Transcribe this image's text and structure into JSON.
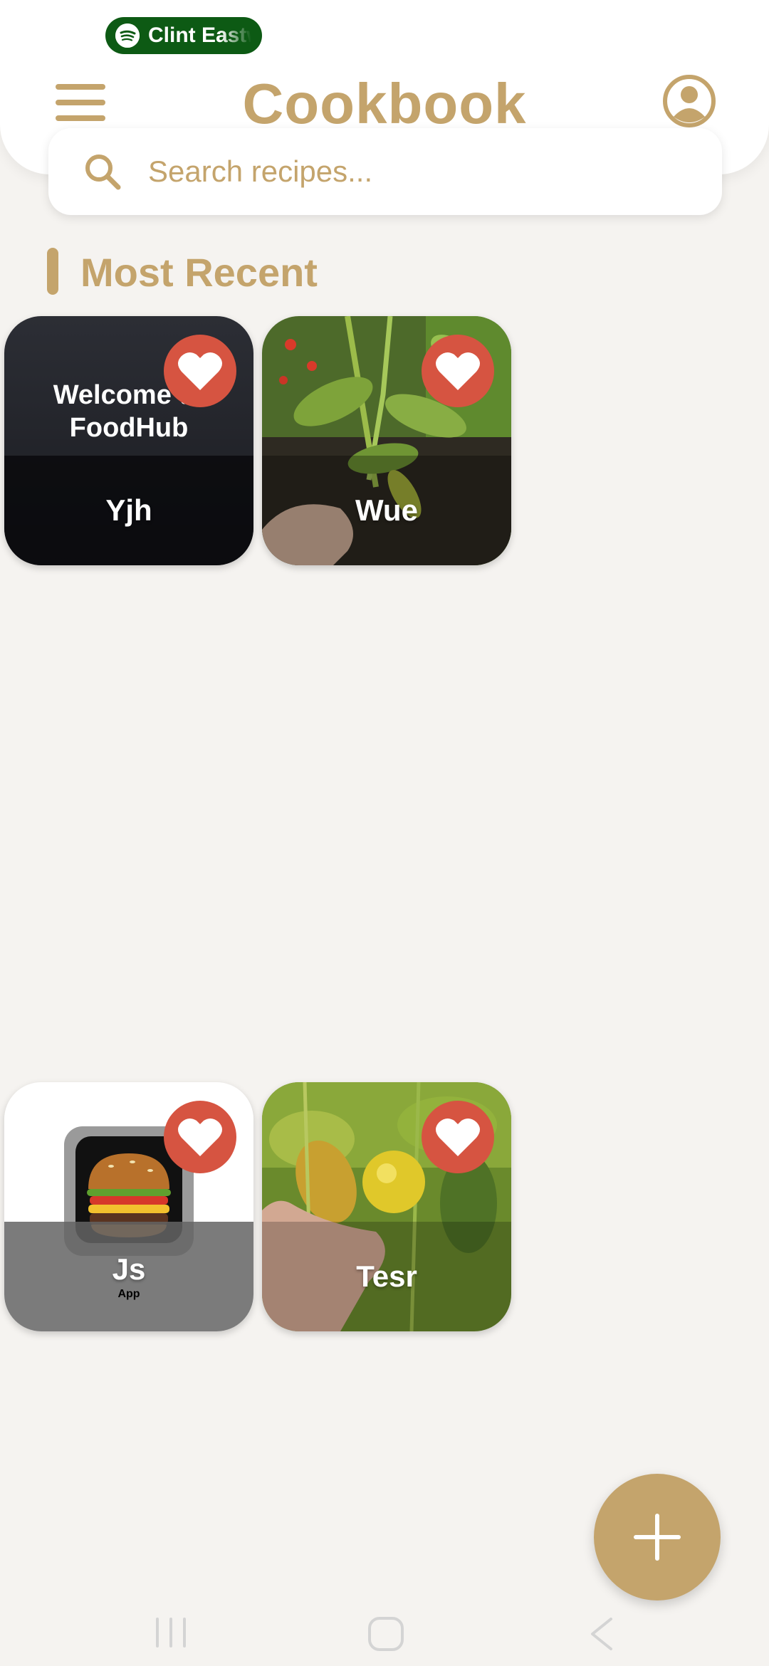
{
  "status": {
    "now_playing": "Clint Eastwood"
  },
  "header": {
    "title": "Cookbook",
    "menu_icon": "hamburger-menu-icon",
    "profile_icon": "account-circle-icon"
  },
  "search": {
    "placeholder": "Search recipes...",
    "value": ""
  },
  "section": {
    "title": "Most Recent"
  },
  "recipes": [
    {
      "name": "Yjh",
      "image_caption": "Welcome to FoodHub",
      "favorite_icon": "heart-icon"
    },
    {
      "name": "Wue",
      "favorite_icon": "heart-icon"
    },
    {
      "name": "Js",
      "subtitle": "App",
      "favorite_icon": "heart-icon"
    },
    {
      "name": "Tesr",
      "favorite_icon": "heart-icon"
    }
  ],
  "fab": {
    "icon": "plus-icon"
  },
  "nav": {
    "recents_icon": "recent-apps-icon",
    "home_icon": "home-icon",
    "back_icon": "back-icon"
  },
  "colors": {
    "accent": "#c4a46c",
    "favorite": "#d65441",
    "background": "#f5f3f0",
    "spotify_pill": "#0d5a14"
  }
}
